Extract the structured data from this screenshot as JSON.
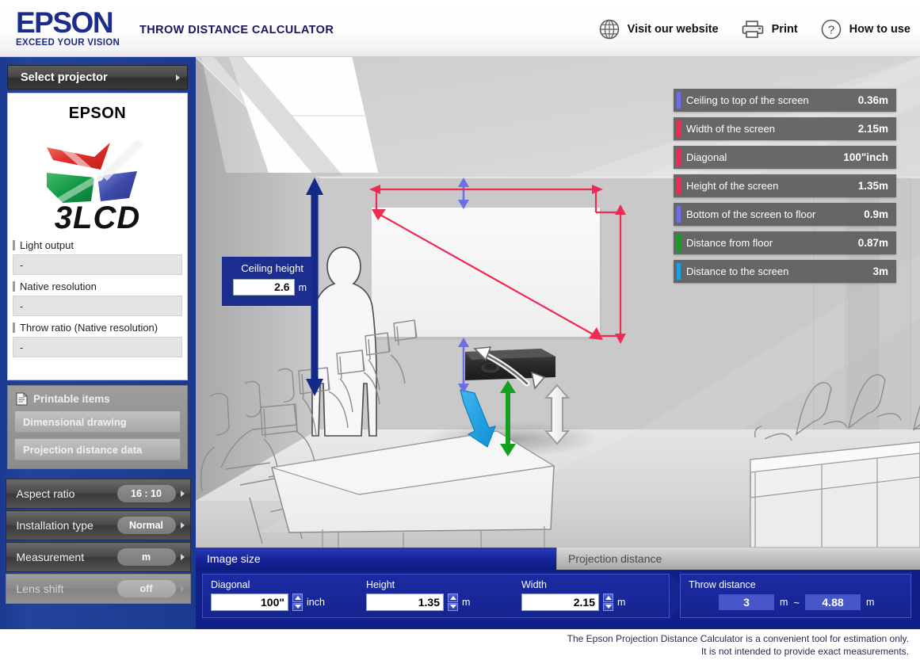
{
  "header": {
    "brand": "EPSON",
    "tagline": "EXCEED YOUR VISION",
    "app_title": "THROW DISTANCE CALCULATOR",
    "actions": [
      {
        "label": "Visit our website",
        "icon": "globe-icon"
      },
      {
        "label": "Print",
        "icon": "printer-icon"
      },
      {
        "label": "How to use",
        "icon": "question-circle-icon"
      }
    ]
  },
  "sidebar": {
    "select_projector": "Select projector",
    "projector_brand": "EPSON",
    "logo_text": "3LCD",
    "specs": [
      {
        "label": "Light output",
        "value": "-"
      },
      {
        "label": "Native resolution",
        "value": "-"
      },
      {
        "label": "Throw ratio (Native resolution)",
        "value": "-"
      }
    ],
    "printable": {
      "title": "Printable items",
      "items": [
        "Dimensional drawing",
        "Projection distance data"
      ]
    },
    "options": [
      {
        "name": "Aspect ratio",
        "value": "16 : 10",
        "disabled": false
      },
      {
        "name": "Installation type",
        "value": "Normal",
        "disabled": false
      },
      {
        "name": "Measurement",
        "value": "m",
        "disabled": false
      },
      {
        "name": "Lens shift",
        "value": "off",
        "disabled": true
      }
    ]
  },
  "stage": {
    "ceiling_height": {
      "label": "Ceiling height",
      "value": "2.6",
      "unit": "m"
    },
    "measurements": [
      {
        "label": "Ceiling to top of the screen",
        "value": "0.36m",
        "color": "#6e6ee8"
      },
      {
        "label": "Width of the screen",
        "value": "2.15m",
        "color": "#ef2a55"
      },
      {
        "label": "Diagonal",
        "value": "100\"inch",
        "color": "#ef2a55"
      },
      {
        "label": "Height of the screen",
        "value": "1.35m",
        "color": "#ef2a55"
      },
      {
        "label": "Bottom of the screen to floor",
        "value": "0.9m",
        "color": "#6e6ee8"
      },
      {
        "label": "Distance from floor",
        "value": "0.87m",
        "color": "#13a020"
      },
      {
        "label": "Distance to the screen",
        "value": "3m",
        "color": "#1e9de8"
      }
    ]
  },
  "bottom": {
    "tabs": [
      {
        "label": "Image size",
        "active": true
      },
      {
        "label": "Projection distance",
        "active": false
      }
    ],
    "image_size": {
      "fields": [
        {
          "label": "Diagonal",
          "value": "100\"",
          "unit": "inch"
        },
        {
          "label": "Height",
          "value": "1.35",
          "unit": "m"
        },
        {
          "label": "Width",
          "value": "2.15",
          "unit": "m"
        }
      ]
    },
    "throw_distance": {
      "label": "Throw distance",
      "min": "3",
      "min_unit": "m",
      "separator": "~",
      "max": "4.88",
      "max_unit": "m"
    }
  },
  "disclaimer": {
    "line1": "The Epson Projection Distance Calculator is a convenient tool for estimation only.",
    "line2": "It is not intended to provide exact measurements."
  },
  "theme": {
    "epson_blue": "#1c2b8c",
    "panel_blue": "#112089",
    "sidebar_blue": "#1b3a8f"
  }
}
